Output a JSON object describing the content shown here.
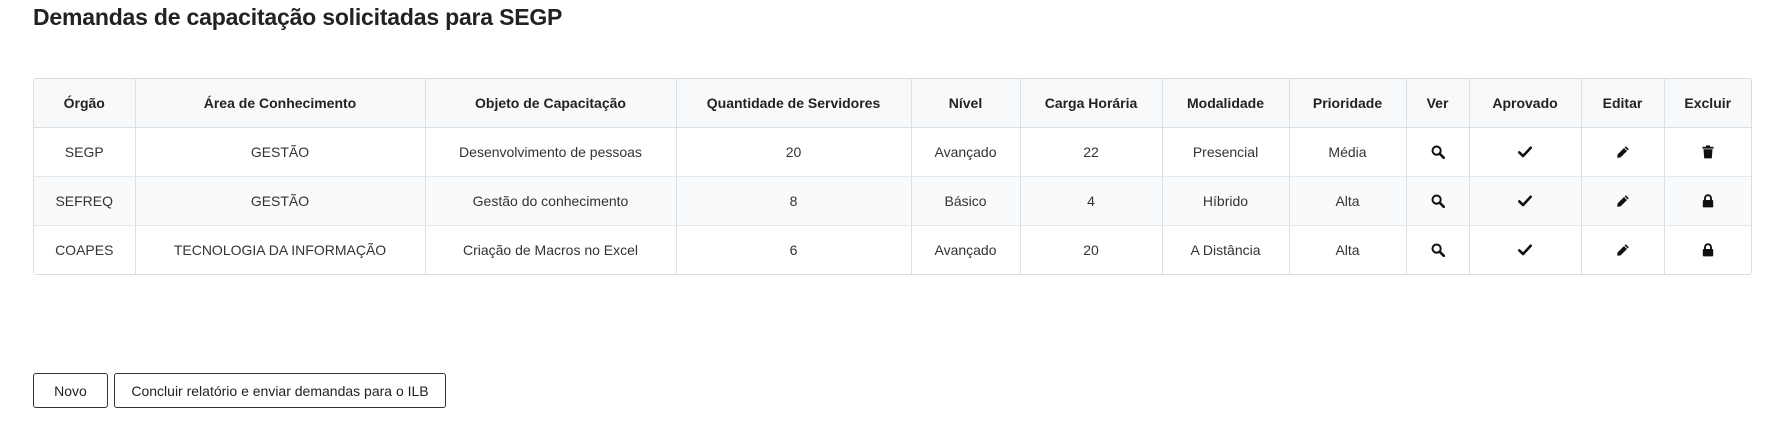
{
  "page": {
    "title": "Demandas de capacitação solicitadas para SEGP"
  },
  "table": {
    "headers": [
      "Órgão",
      "Área de Conhecimento",
      "Objeto de Capacitação",
      "Quantidade de Servidores",
      "Nível",
      "Carga Horária",
      "Modalidade",
      "Prioridade",
      "Ver",
      "Aprovado",
      "Editar",
      "Excluir"
    ],
    "rows": [
      {
        "orgao": "SEGP",
        "area": "GESTÃO",
        "objeto": "Desenvolvimento de pessoas",
        "quantidade": "20",
        "nivel": "Avançado",
        "carga": "22",
        "modalidade": "Presencial",
        "prioridade": "Média",
        "ver_icon": "search-icon",
        "aprovado_icon": "checkmark-icon",
        "editar_icon": "pencil-icon",
        "excluir_icon": "trash-icon"
      },
      {
        "orgao": "SEFREQ",
        "area": "GESTÃO",
        "objeto": "Gestão do conhecimento",
        "quantidade": "8",
        "nivel": "Básico",
        "carga": "4",
        "modalidade": "Híbrido",
        "prioridade": "Alta",
        "ver_icon": "search-icon",
        "aprovado_icon": "checkmark-icon",
        "editar_icon": "pencil-icon",
        "excluir_icon": "lock-icon"
      },
      {
        "orgao": "COAPES",
        "area": "TECNOLOGIA DA INFORMAÇÃO",
        "objeto": "Criação de Macros no Excel",
        "quantidade": "6",
        "nivel": "Avançado",
        "carga": "20",
        "modalidade": "A Distância",
        "prioridade": "Alta",
        "ver_icon": "search-icon",
        "aprovado_icon": "checkmark-icon",
        "editar_icon": "pencil-icon",
        "excluir_icon": "lock-icon"
      }
    ]
  },
  "actions": {
    "novo_label": "Novo",
    "concluir_label": "Concluir relatório e enviar demandas para o ILB"
  },
  "colors": {
    "text": "#222222",
    "border": "#dcdfe4",
    "header_bg": "#f8f9fb"
  }
}
